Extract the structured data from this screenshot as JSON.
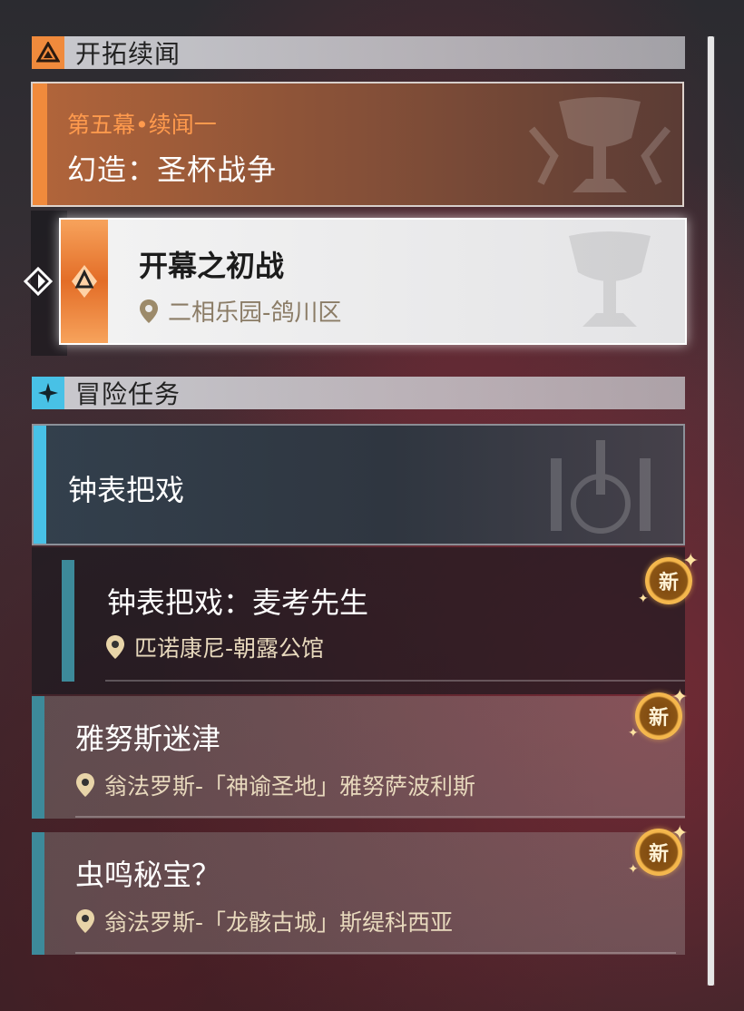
{
  "colors": {
    "trailblaze_accent": "#f08a3c",
    "adventure_accent": "#48c1e6",
    "sub_accent": "#3d8a9a",
    "badge_gold": "#f4b54a"
  },
  "sections": {
    "trailblaze": {
      "header": "开拓续闻",
      "icon": "trailblaze-triangle-icon",
      "card": {
        "subtitle": "第五幕•续闻一",
        "title": "幻造：圣杯战争"
      },
      "selected_mission": {
        "title": "开幕之初战",
        "location": "二相乐园-鸽川区"
      }
    },
    "adventure": {
      "header": "冒险任务",
      "icon": "adventure-star-icon",
      "card": {
        "title": "钟表把戏"
      },
      "missions": [
        {
          "title": "钟表把戏：麦考先生",
          "location": "匹诺康尼-朝露公馆",
          "badge": "新"
        },
        {
          "title": "雅努斯迷津",
          "location": "翁法罗斯-「神谕圣地」雅努萨波利斯",
          "badge": "新"
        },
        {
          "title": "虫鸣秘宝？",
          "location": "翁法罗斯-「龙骸古城」斯缇科西亚",
          "badge": "新"
        }
      ]
    }
  }
}
